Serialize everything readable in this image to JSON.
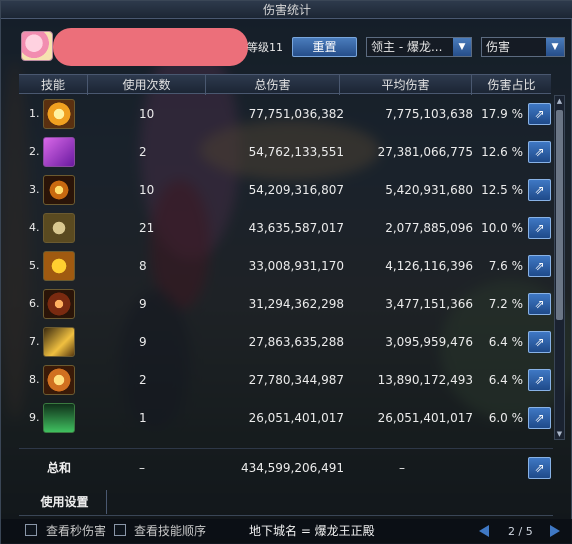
{
  "window": {
    "title": "伤害统计"
  },
  "header": {
    "level_text": "等级11",
    "reset_label": "重置",
    "dungeon_select": "领主 - 爆龙...",
    "metric_select": "伤害"
  },
  "table": {
    "columns": [
      "技能",
      "使用次数",
      "总伤害",
      "平均伤害",
      "伤害占比"
    ],
    "rows": [
      {
        "rank": "1.",
        "icon": "skill-sun-icon",
        "uses": "10",
        "total": "77,751,036,382",
        "avg": "7,775,103,638",
        "pct": "17.9 %"
      },
      {
        "rank": "2.",
        "icon": "skill-purple-icon",
        "uses": "2",
        "total": "54,762,133,551",
        "avg": "27,381,066,775",
        "pct": "12.6 %"
      },
      {
        "rank": "3.",
        "icon": "skill-flame-ring-icon",
        "uses": "10",
        "total": "54,209,316,807",
        "avg": "5,420,931,680",
        "pct": "12.5 %"
      },
      {
        "rank": "4.",
        "icon": "skill-compass-icon",
        "uses": "21",
        "total": "43,635,587,017",
        "avg": "2,077,885,096",
        "pct": "10.0 %"
      },
      {
        "rank": "5.",
        "icon": "skill-lion-icon",
        "uses": "8",
        "total": "33,008,931,170",
        "avg": "4,126,116,396",
        "pct": "7.6 %"
      },
      {
        "rank": "6.",
        "icon": "skill-burst-icon",
        "uses": "9",
        "total": "31,294,362,298",
        "avg": "3,477,151,366",
        "pct": "7.2 %"
      },
      {
        "rank": "7.",
        "icon": "skill-beast-icon",
        "uses": "9",
        "total": "27,863,635,288",
        "avg": "3,095,959,476",
        "pct": "6.4 %"
      },
      {
        "rank": "8.",
        "icon": "skill-phoenix-icon",
        "uses": "2",
        "total": "27,780,344,987",
        "avg": "13,890,172,493",
        "pct": "6.4 %"
      },
      {
        "rank": "9.",
        "icon": "skill-jade-icon",
        "uses": "1",
        "total": "26,051,401,017",
        "avg": "26,051,401,017",
        "pct": "6.0 %"
      }
    ],
    "sum": {
      "label": "总和",
      "uses": "–",
      "total": "434,599,206,491",
      "avg": "–"
    }
  },
  "settings_tab": "使用设置",
  "footer": {
    "check1_label": "查看秒伤害",
    "check2_label": "查看技能顺序",
    "dungeon_name": "地下城名 = 爆龙王正殿",
    "page": "2 / 5"
  },
  "colors": {
    "accent": "#3f78c4",
    "panel": "#0e141c",
    "redaction": "#ec6f7a"
  }
}
